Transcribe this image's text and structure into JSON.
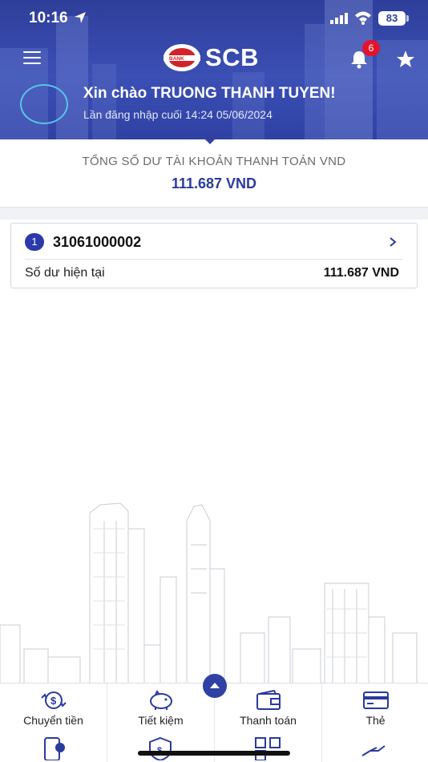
{
  "status_bar": {
    "time": "10:16",
    "battery": "83"
  },
  "header": {
    "logo_text": "SCB",
    "logo_sub": "BANK",
    "notification_count": "6",
    "greeting": "Xin chào TRUONG THANH TUYEN!",
    "last_login": "Lần đăng nhập cuối 14:24 05/06/2024"
  },
  "summary": {
    "label": "TỔNG SỐ DƯ TÀI KHOẢN THANH TOÁN VND",
    "value": "111.687 VND"
  },
  "account": {
    "index": "1",
    "number": "31061000002",
    "balance_label": "Số dư hiện tại",
    "balance_value": "111.687 VND"
  },
  "bottom_nav": {
    "items": [
      {
        "label": "Chuyển tiền",
        "icon": "transfer-icon"
      },
      {
        "label": "Tiết kiệm",
        "icon": "piggy-bank-icon"
      },
      {
        "label": "Thanh toán",
        "icon": "wallet-icon"
      },
      {
        "label": "Thẻ",
        "icon": "card-icon"
      }
    ],
    "row2_icons": [
      "phone-topup-icon",
      "insurance-shield-icon",
      "qr-code-icon",
      "loan-hand-icon"
    ]
  },
  "colors": {
    "header_blue": "#2f41a3",
    "accent_blue": "#2a3a9e",
    "badge_red": "#e2142d"
  }
}
